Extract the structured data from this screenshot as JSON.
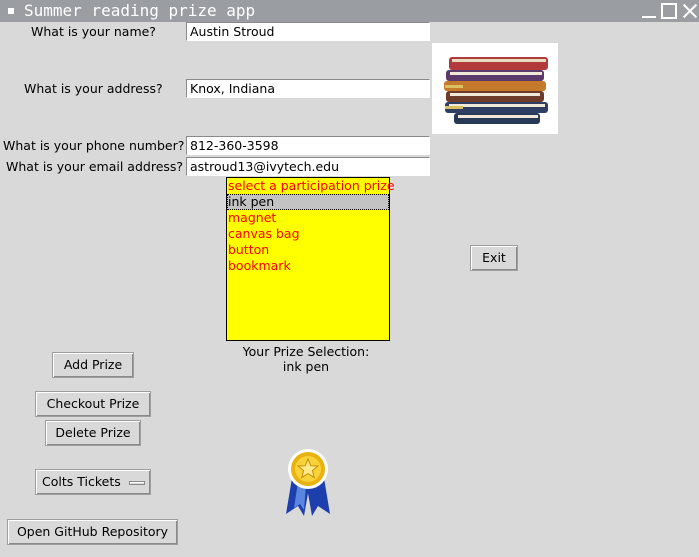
{
  "window": {
    "title": "Summer reading prize app"
  },
  "form": {
    "name_label": "What is your name?",
    "name_value": "Austin Stroud",
    "address_label": "What is your address?",
    "address_value": "Knox, Indiana",
    "phone_label": "What is your phone number?",
    "phone_value": "812-360-3598",
    "email_label": "What is your email address?",
    "email_value": "astroud13@ivytech.edu"
  },
  "prize_list": {
    "items": [
      "select a participation prize",
      "ink pen",
      "magnet",
      "canvas bag",
      "button",
      "bookmark"
    ],
    "selected": "ink pen",
    "text_color": "#ff0000",
    "background": "#ffff00"
  },
  "selection": {
    "caption": "Your Prize Selection:",
    "value": "ink pen"
  },
  "buttons": {
    "exit": "Exit",
    "add_prize": "Add Prize",
    "checkout_prize": "Checkout Prize",
    "delete_prize": "Delete Prize",
    "open_repo": "Open GitHub Repository"
  },
  "menu": {
    "selected": "Colts Tickets"
  },
  "images": {
    "books": "stack-of-books-icon",
    "ribbon": "award-ribbon-icon"
  }
}
